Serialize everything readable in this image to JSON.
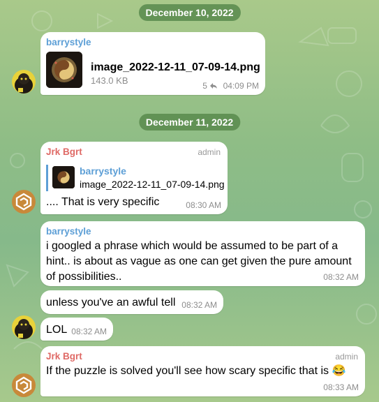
{
  "dates": [
    "December 10, 2022",
    "December 11, 2022"
  ],
  "messages": [
    {
      "sender": "barrystyle",
      "file_name": "image_2022-12-11_07-09-14.png",
      "file_size": "143.0 KB",
      "replies": "5",
      "time": "04:09 PM"
    },
    {
      "sender": "Jrk Bgrt",
      "role": "admin",
      "reply_sender": "barrystyle",
      "reply_text": "image_2022-12-11_07-09-14.png",
      "text": ".... That is very specific",
      "time": "08:30 AM"
    },
    {
      "sender": "barrystyle",
      "text": "i googled a phrase which would be assumed to be part of a hint.. is about as vague as one can get given the pure amount of possibilities..",
      "time": "08:32 AM"
    },
    {
      "text": "unless you've an awful tell",
      "time": "08:32 AM"
    },
    {
      "text": "LOL",
      "time": "08:32 AM"
    },
    {
      "sender": "Jrk Bgrt",
      "role": "admin",
      "text": "If the puzzle is solved you'll see how scary specific that is 😂",
      "time": "08:33 AM"
    }
  ],
  "colors": {
    "background": "#96c189",
    "date_chip": "#588a4c",
    "sender_blue": "#5d9fd6",
    "sender_red": "#df6a66"
  },
  "icons": [
    "reply-arrow-icon",
    "emoji-joy-icon",
    "yin-yang-image-icon"
  ]
}
